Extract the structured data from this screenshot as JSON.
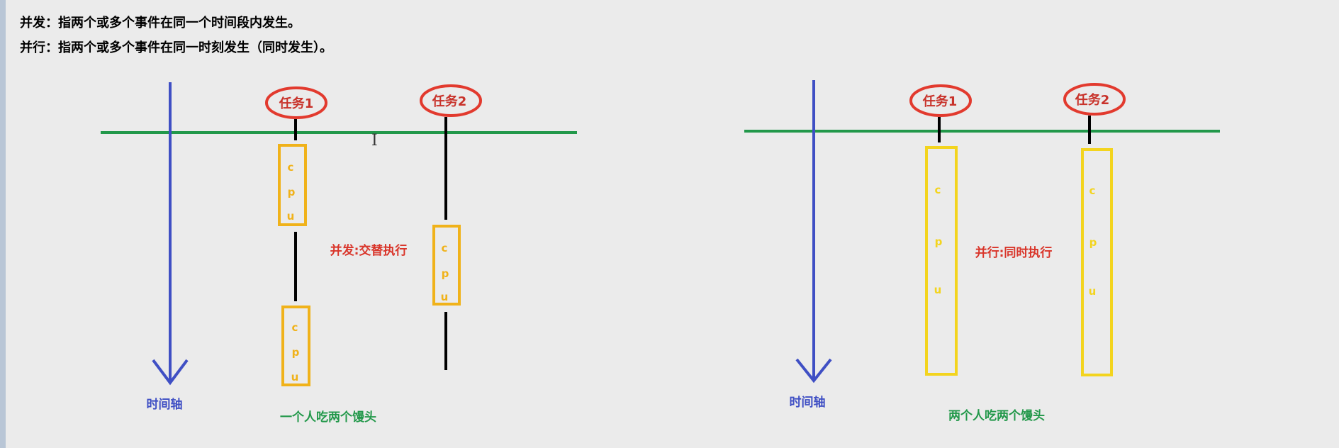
{
  "definitions": {
    "concurrency": "并发：指两个或多个事件在同一个时间段内发生。",
    "parallel": "并行：指两个或多个事件在同一时刻发生（同时发生）。"
  },
  "left_diagram": {
    "task1": "任务1",
    "task2": "任务2",
    "axis_label": "时间轴",
    "middle_label": "并发:交替执行",
    "caption": "一个人吃两个馒头",
    "cpu_letters": [
      "c",
      "p",
      "u"
    ]
  },
  "right_diagram": {
    "task1": "任务1",
    "task2": "任务2",
    "axis_label": "时间轴",
    "middle_label": "并行:同时执行",
    "caption": "两个人吃两个馒头",
    "cpu_letters": [
      "c",
      "p",
      "u"
    ]
  },
  "colors": {
    "axis": "#3f4fc4",
    "horizon": "#22984a",
    "ellipse": "#e23a2e",
    "task_text": "#c8322a",
    "cpu_box": "#f0b21a",
    "cpu_box_right": "#f3d41e",
    "caption": "#22984a",
    "middle_label": "#d9352a"
  }
}
